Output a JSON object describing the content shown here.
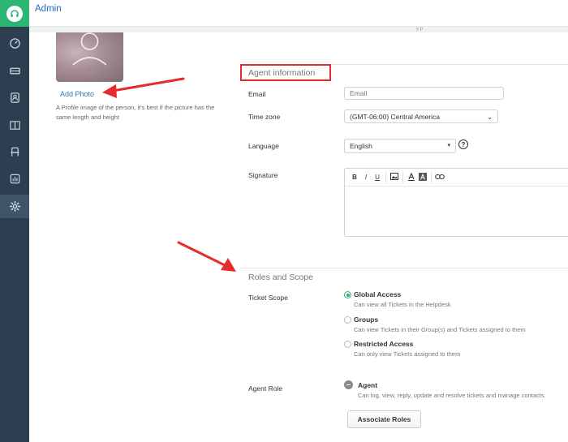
{
  "header": {
    "title": "Admin"
  },
  "sidebar": {
    "icons": [
      "dashboard-icon",
      "tickets-icon",
      "contacts-icon",
      "book-icon",
      "chair-icon",
      "reports-icon",
      "settings-icon"
    ],
    "active": "settings-icon",
    "brand_color": "#2bb673",
    "bg_color": "#2c3e50"
  },
  "profile": {
    "add_photo": "Add Photo",
    "help": "A Profile image of the person, it's best if the picture has the same length and height"
  },
  "agent_info": {
    "title": "Agent information",
    "email_label": "Email",
    "email_placeholder": "Email",
    "timezone_label": "Time zone",
    "timezone_value": "(GMT-06:00) Central America",
    "language_label": "Language",
    "language_value": "English",
    "help_symbol": "?",
    "signature_label": "Signature",
    "toolbar": [
      "B",
      "I",
      "U",
      "image-icon",
      "text-color-icon",
      "background-color-icon",
      "link-icon"
    ]
  },
  "roles": {
    "title": "Roles and Scope",
    "ticket_scope_label": "Ticket Scope",
    "options": [
      {
        "title": "Global Access",
        "desc": "Can view all Tickets in the Helpdesk",
        "selected": true
      },
      {
        "title": "Groups",
        "desc": "Can view Tickets in their Group(s) and Tickets assigned to them",
        "selected": false
      },
      {
        "title": "Restricted Access",
        "desc": "Can only view Tickets assigned to them",
        "selected": false
      }
    ],
    "agent_role_label": "Agent Role",
    "agent_title": "Agent",
    "agent_desc": "Can log, view, reply, update and resolve tickets and manage contacts.",
    "associate_button": "Associate Roles"
  },
  "annotation_color": "#e52b2b"
}
